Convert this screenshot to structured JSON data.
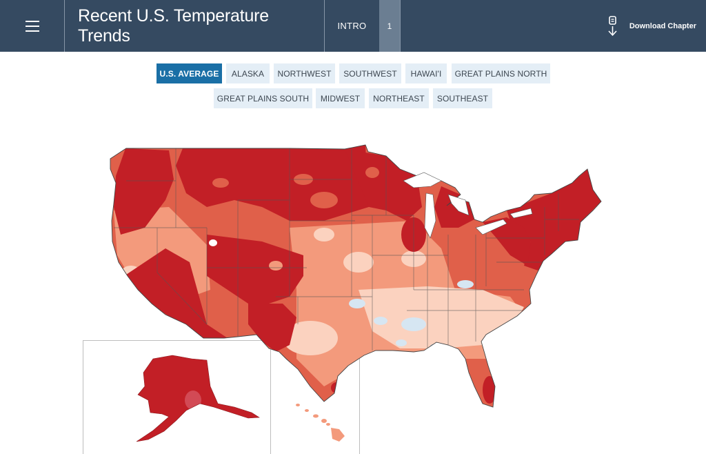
{
  "header": {
    "title": "Recent U.S. Temperature Trends",
    "intro_label": "INTRO",
    "page_number": "1",
    "download_label": "Download Chapter",
    "background_color": "#354a61"
  },
  "regions": {
    "active_color": "#1a6fa6",
    "items": [
      {
        "label": "U.S. AVERAGE",
        "active": true
      },
      {
        "label": "ALASKA",
        "active": false
      },
      {
        "label": "NORTHWEST",
        "active": false
      },
      {
        "label": "SOUTHWEST",
        "active": false
      },
      {
        "label": "HAWAI'I",
        "active": false
      },
      {
        "label": "GREAT PLAINS NORTH",
        "active": false
      },
      {
        "label": "GREAT PLAINS SOUTH",
        "active": false
      },
      {
        "label": "MIDWEST",
        "active": false
      },
      {
        "label": "NORTHEAST",
        "active": false
      },
      {
        "label": "SOUTHEAST",
        "active": false
      }
    ]
  },
  "map": {
    "colors": {
      "strongest_warming": "#c21f26",
      "strong_warming": "#e0604a",
      "moderate_warming": "#f39a7c",
      "slight_warming": "#fbd2bf",
      "slight_cooling": "#d6e6f2",
      "cooling": "#8ebcd8",
      "state_border": "#555555"
    }
  }
}
